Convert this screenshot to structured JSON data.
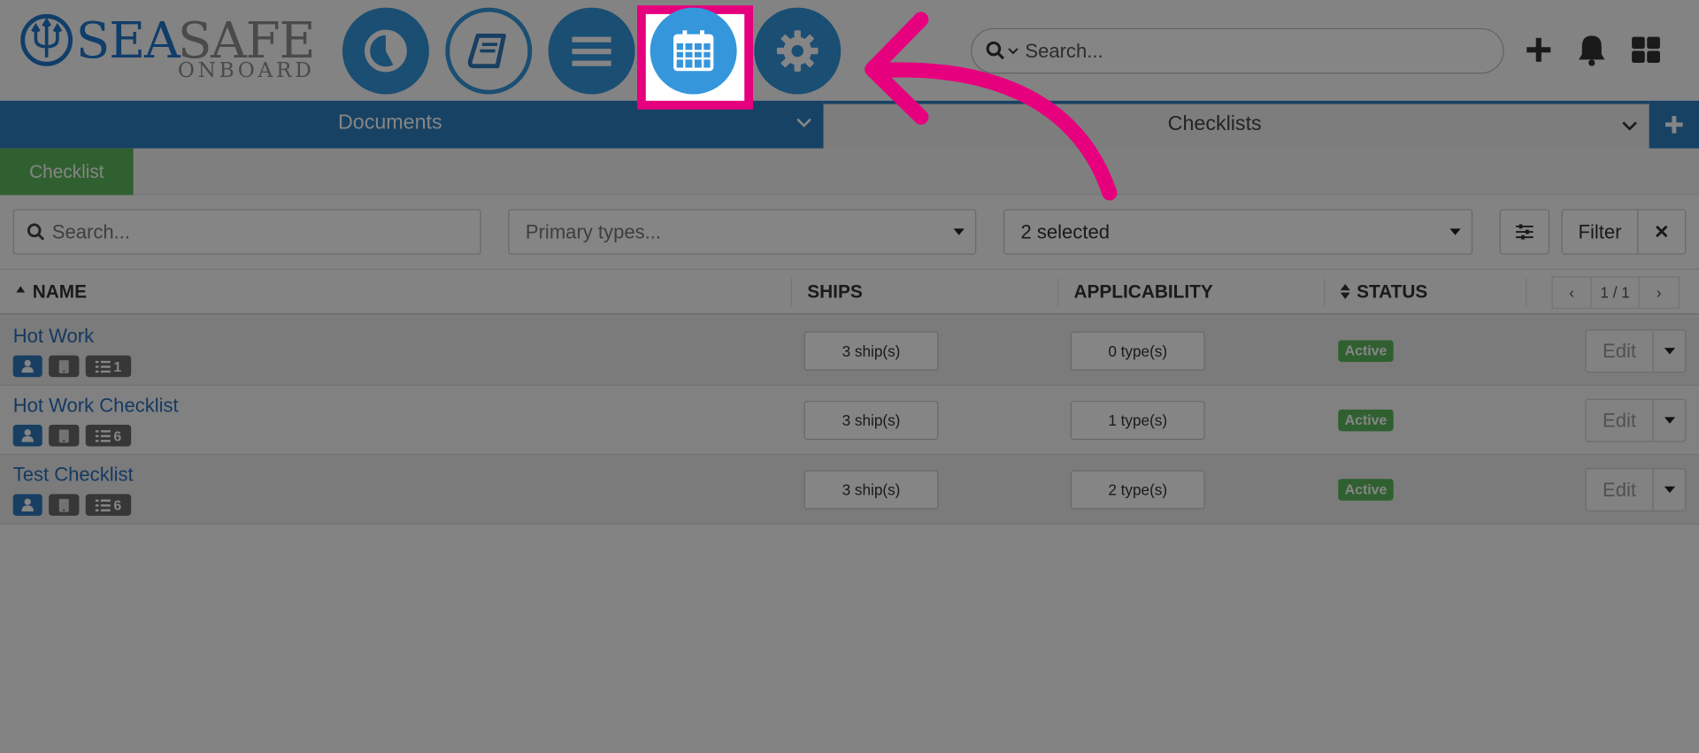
{
  "brand": {
    "name_part1": "SEA",
    "name_part2": "SAFE",
    "subtitle": "ONBOARD",
    "primary_color": "#1f75c9",
    "secondary_color": "#8e8e8e"
  },
  "nav": {
    "items": [
      {
        "icon": "pie-chart-icon"
      },
      {
        "icon": "book-icon"
      },
      {
        "icon": "menu-icon"
      },
      {
        "icon": "calendar-icon",
        "highlighted": true
      },
      {
        "icon": "gear-icon"
      }
    ],
    "highlight_color": "#e6007e"
  },
  "top_search": {
    "placeholder": "Search..."
  },
  "header_icons": [
    "plus-icon",
    "bell-icon",
    "grid-icon"
  ],
  "tabs": [
    {
      "label": "Documents",
      "active": true
    },
    {
      "label": "Checklists",
      "active": false
    }
  ],
  "subtab": {
    "label": "Checklist"
  },
  "filters": {
    "search_placeholder": "Search...",
    "primary_types_placeholder": "Primary types...",
    "selected_text": "2 selected",
    "filter_label": "Filter",
    "clear_label": "×"
  },
  "table": {
    "columns": {
      "name": "NAME",
      "ships": "SHIPS",
      "applicability": "APPLICABILITY",
      "status": "STATUS"
    },
    "pager": {
      "prev": "‹",
      "page": "1 / 1",
      "next": "›"
    },
    "rows": [
      {
        "name": "Hot Work",
        "count": "1",
        "ships": "3 ship(s)",
        "types": "0 type(s)",
        "status": "Active",
        "edit": "Edit"
      },
      {
        "name": "Hot Work Checklist",
        "count": "6",
        "ships": "3 ship(s)",
        "types": "1 type(s)",
        "status": "Active",
        "edit": "Edit"
      },
      {
        "name": "Test Checklist",
        "count": "6",
        "ships": "3 ship(s)",
        "types": "2 type(s)",
        "status": "Active",
        "edit": "Edit"
      }
    ]
  },
  "colors": {
    "accent_blue": "#3596dc",
    "tab_blue": "#2c7fc0",
    "success_green": "#5cb85c",
    "link_blue": "#2a6ebb"
  }
}
